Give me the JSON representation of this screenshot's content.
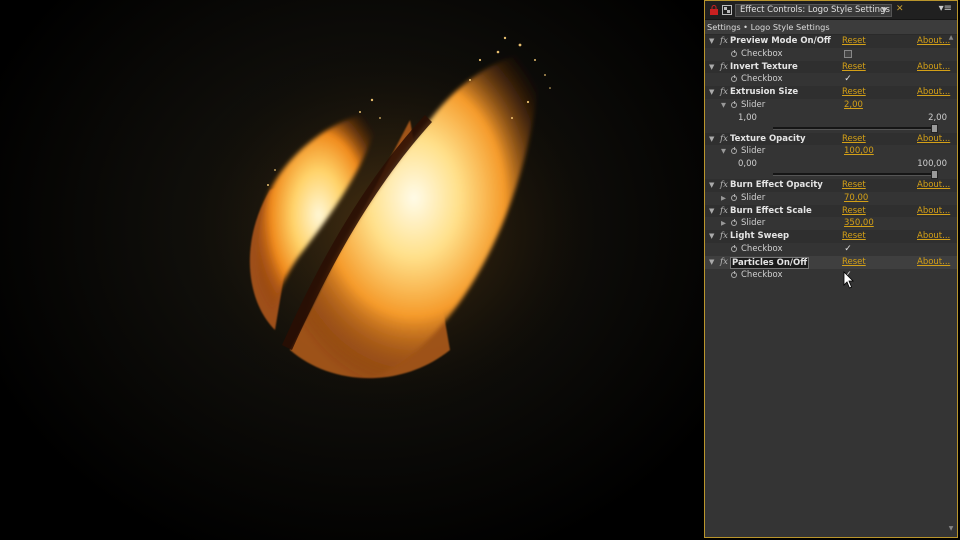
{
  "panel": {
    "tab_title": "Effect Controls: Logo Style Settings",
    "breadcrumb": "Settings • Logo Style Settings",
    "menu_icon": "panel-menu-icon",
    "accent_color": "#d4a017"
  },
  "effects": [
    {
      "name": "Preview Mode On/Off",
      "reset": "Reset",
      "about": "About...",
      "param": {
        "label": "Checkbox",
        "type": "checkbox",
        "checked": false
      }
    },
    {
      "name": "Invert Texture",
      "reset": "Reset",
      "about": "About...",
      "param": {
        "label": "Checkbox",
        "type": "checkbox",
        "checked": true
      }
    },
    {
      "name": "Extrusion Size",
      "reset": "Reset",
      "about": "About...",
      "param": {
        "label": "Slider",
        "type": "slider",
        "value": "2,00",
        "min": "1,00",
        "max": "2,00",
        "level": 1.0,
        "expanded": true
      }
    },
    {
      "name": "Texture Opacity",
      "reset": "Reset",
      "about": "About...",
      "param": {
        "label": "Slider",
        "type": "slider",
        "value": "100,00",
        "min": "0,00",
        "max": "100,00",
        "level": 1.0,
        "expanded": true
      }
    },
    {
      "name": "Burn Effect Opacity",
      "reset": "Reset",
      "about": "About...",
      "param": {
        "label": "Slider",
        "type": "slider",
        "value": "70,00",
        "expanded": false
      }
    },
    {
      "name": "Burn Effect Scale",
      "reset": "Reset",
      "about": "About...",
      "param": {
        "label": "Slider",
        "type": "slider",
        "value": "350,00",
        "expanded": false
      }
    },
    {
      "name": "Light Sweep",
      "reset": "Reset",
      "about": "About...",
      "param": {
        "label": "Checkbox",
        "type": "checkbox",
        "checked": true
      }
    },
    {
      "name": "Particles On/Off",
      "reset": "Reset",
      "about": "About...",
      "selected": true,
      "param": {
        "label": "Checkbox",
        "type": "checkbox",
        "checked": true
      }
    }
  ]
}
